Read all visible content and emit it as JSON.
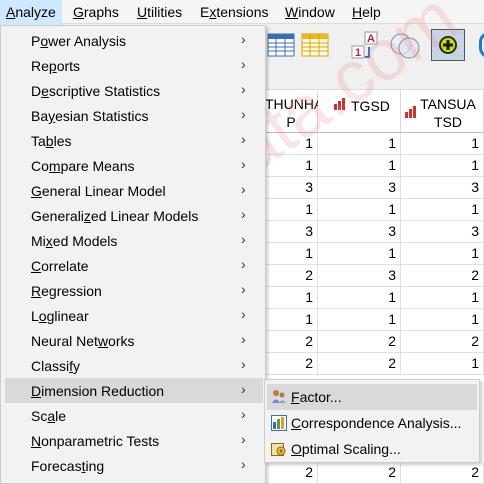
{
  "menubar": {
    "items": [
      {
        "pre": "",
        "key": "A",
        "post": "nalyze"
      },
      {
        "pre": "",
        "key": "G",
        "post": "raphs"
      },
      {
        "pre": "",
        "key": "U",
        "post": "tilities"
      },
      {
        "pre": "E",
        "key": "x",
        "post": "tensions"
      },
      {
        "pre": "",
        "key": "W",
        "post": "indow"
      },
      {
        "pre": "",
        "key": "H",
        "post": "elp"
      }
    ]
  },
  "analyze_menu": {
    "items": [
      {
        "pre": "P",
        "key": "o",
        "post": "wer Analysis"
      },
      {
        "pre": "Re",
        "key": "p",
        "post": "orts"
      },
      {
        "pre": "D",
        "key": "e",
        "post": "scriptive Statistics"
      },
      {
        "pre": "Ba",
        "key": "y",
        "post": "esian Statistics"
      },
      {
        "pre": "Ta",
        "key": "b",
        "post": "les"
      },
      {
        "pre": "Co",
        "key": "m",
        "post": "pare Means"
      },
      {
        "pre": "",
        "key": "G",
        "post": "eneral Linear Model"
      },
      {
        "pre": "Generali",
        "key": "z",
        "post": "ed Linear Models"
      },
      {
        "pre": "Mi",
        "key": "x",
        "post": "ed Models"
      },
      {
        "pre": "",
        "key": "C",
        "post": "orrelate"
      },
      {
        "pre": "",
        "key": "R",
        "post": "egression"
      },
      {
        "pre": "L",
        "key": "o",
        "post": "glinear"
      },
      {
        "pre": "Neural Net",
        "key": "w",
        "post": "orks"
      },
      {
        "pre": "Classi",
        "key": "f",
        "post": "y"
      },
      {
        "pre": "",
        "key": "D",
        "post": "imension Reduction"
      },
      {
        "pre": "Sc",
        "key": "a",
        "post": "le"
      },
      {
        "pre": "",
        "key": "N",
        "post": "onparametric Tests"
      },
      {
        "pre": "Forecas",
        "key": "t",
        "post": "ing"
      }
    ],
    "arrow": "›"
  },
  "dimension_submenu": {
    "items": [
      {
        "pre": "",
        "key": "F",
        "post": "actor...",
        "icon": "factor-icon"
      },
      {
        "pre": "",
        "key": "C",
        "post": "orrespondence Analysis...",
        "icon": "correspondence-icon"
      },
      {
        "pre": "",
        "key": "O",
        "post": "ptimal Scaling...",
        "icon": "optimal-scaling-icon"
      }
    ]
  },
  "grid": {
    "columns": [
      {
        "label": "THUNHA P"
      },
      {
        "label": "TGSD"
      },
      {
        "label": "TANSUA TSD"
      }
    ],
    "rows": [
      [
        "1",
        "1",
        "1"
      ],
      [
        "1",
        "1",
        "1"
      ],
      [
        "3",
        "3",
        "3"
      ],
      [
        "1",
        "1",
        "1"
      ],
      [
        "3",
        "3",
        "3"
      ],
      [
        "1",
        "1",
        "1"
      ],
      [
        "2",
        "3",
        "2"
      ],
      [
        "1",
        "1",
        "1"
      ],
      [
        "1",
        "1",
        "1"
      ],
      [
        "2",
        "2",
        "2"
      ],
      [
        "2",
        "2",
        "1"
      ]
    ],
    "last_row": [
      "2",
      "2",
      "2"
    ]
  },
  "toolbar": {
    "icons": [
      "insert-cases-icon",
      "insert-variable-icon",
      "value-labels-icon",
      "use-sets-icon",
      "add-on-icon"
    ]
  },
  "watermark": "esdata.com",
  "colors": {
    "highlight": "#d9d9d9",
    "menubar_active": "#cde8ff",
    "menu_bg": "#f2f2f2"
  }
}
